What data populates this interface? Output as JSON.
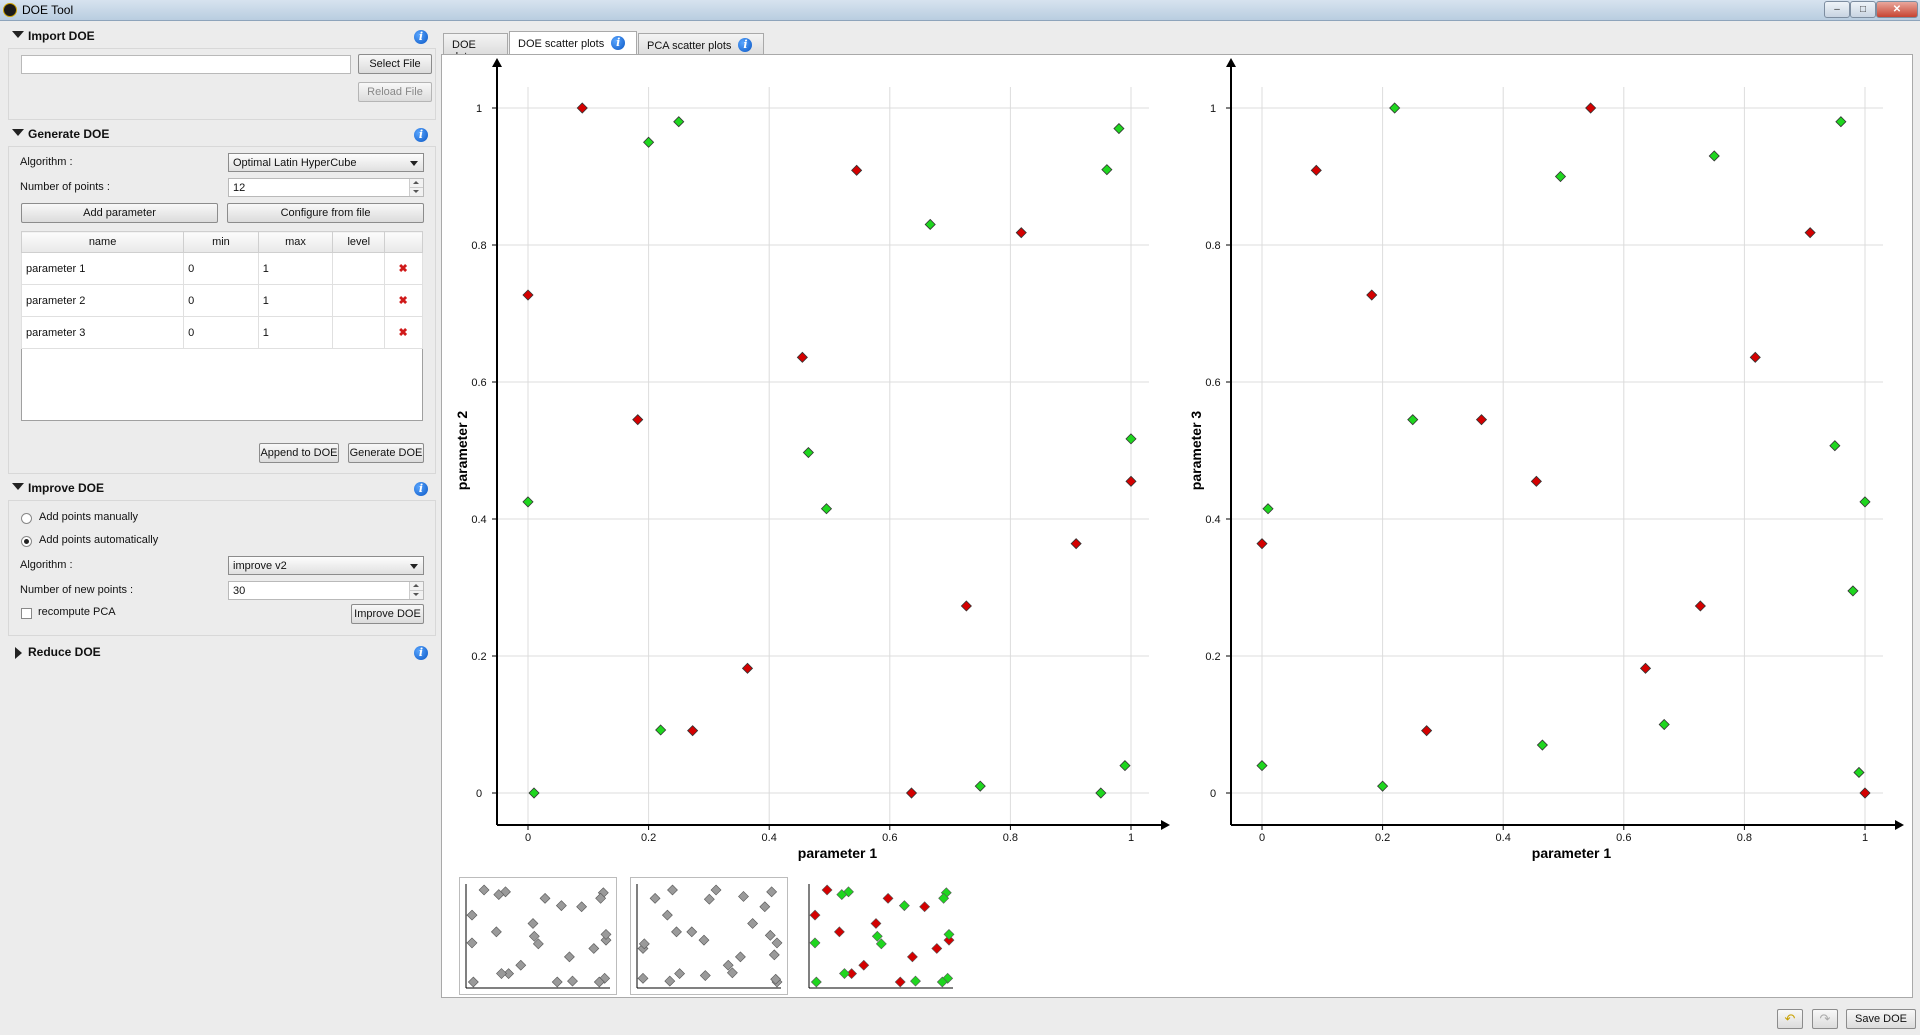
{
  "window": {
    "title": "DOE Tool",
    "buttons": {
      "minimize": "–",
      "maximize": "□",
      "close": "✕"
    }
  },
  "import": {
    "title": "Import DOE",
    "file_value": "",
    "select_label": "Select File",
    "reload_label": "Reload File"
  },
  "generate": {
    "title": "Generate DOE",
    "algorithm_label": "Algorithm :",
    "algorithm_value": "Optimal Latin HyperCube",
    "npoints_label": "Number of points :",
    "npoints_value": "12",
    "add_param_label": "Add parameter",
    "configure_label": "Configure from file",
    "columns": [
      "name",
      "min",
      "max",
      "level"
    ],
    "rows": [
      {
        "name": "parameter 1",
        "min": "0",
        "max": "1",
        "level": ""
      },
      {
        "name": "parameter 2",
        "min": "0",
        "max": "1",
        "level": ""
      },
      {
        "name": "parameter 3",
        "min": "0",
        "max": "1",
        "level": ""
      }
    ],
    "delete_glyph": "✖",
    "append_label": "Append to DOE",
    "generate_label": "Generate DOE"
  },
  "improve": {
    "title": "Improve DOE",
    "manual_label": "Add points manually",
    "auto_label": "Add points automatically",
    "mode_selected": "auto",
    "algorithm_label": "Algorithm :",
    "algorithm_value": "improve v2",
    "newpoints_label": "Number of new points :",
    "newpoints_value": "30",
    "recompute_label": "recompute PCA",
    "recompute_checked": false,
    "improve_label": "Improve DOE"
  },
  "reduce": {
    "title": "Reduce DOE"
  },
  "info_glyph": "i",
  "tabs": [
    {
      "label": "DOE data",
      "active": false,
      "info": false
    },
    {
      "label": "DOE scatter plots",
      "active": true,
      "info": true
    },
    {
      "label": "PCA scatter plots",
      "active": false,
      "info": true
    }
  ],
  "footer": {
    "undo_glyph": "↶",
    "redo_glyph": "↷",
    "save_label": "Save DOE"
  },
  "colors": {
    "red": "#d40000",
    "green": "#1fd61f",
    "grey": "#9a9a9a"
  },
  "chart_data": [
    {
      "type": "scatter",
      "xlabel": "parameter 1",
      "ylabel": "parameter 2",
      "xlim": [
        0,
        1
      ],
      "ylim": [
        0,
        1
      ],
      "xticks": [
        "0",
        "0.2",
        "0.4",
        "0.6",
        "0.8",
        "1"
      ],
      "yticks": [
        "0",
        "0.2",
        "0.4",
        "0.6",
        "0.8",
        "1"
      ],
      "grid": true,
      "series": [
        {
          "color": "#d40000",
          "points": [
            [
              0.09,
              1.0
            ],
            [
              0.0,
              0.727
            ],
            [
              0.545,
              0.909
            ],
            [
              0.818,
              0.818
            ],
            [
              0.455,
              0.636
            ],
            [
              0.182,
              0.545
            ],
            [
              1.0,
              0.455
            ],
            [
              0.909,
              0.364
            ],
            [
              0.727,
              0.273
            ],
            [
              0.364,
              0.182
            ],
            [
              0.273,
              0.091
            ],
            [
              0.636,
              0.0
            ]
          ]
        },
        {
          "color": "#1fd61f",
          "points": [
            [
              0.25,
              0.98
            ],
            [
              0.2,
              0.95
            ],
            [
              0.98,
              0.97
            ],
            [
              0.96,
              0.91
            ],
            [
              0.667,
              0.83
            ],
            [
              1.0,
              0.517
            ],
            [
              0.465,
              0.497
            ],
            [
              0.0,
              0.425
            ],
            [
              0.495,
              0.415
            ],
            [
              0.22,
              0.092
            ],
            [
              0.99,
              0.04
            ],
            [
              0.75,
              0.01
            ],
            [
              0.01,
              0.0
            ],
            [
              0.95,
              0.0
            ]
          ]
        }
      ]
    },
    {
      "type": "scatter",
      "xlabel": "parameter 1",
      "ylabel": "parameter 3",
      "xlim": [
        0,
        1
      ],
      "ylim": [
        0,
        1
      ],
      "xticks": [
        "0",
        "0.2",
        "0.4",
        "0.6",
        "0.8",
        "1"
      ],
      "yticks": [
        "0",
        "0.2",
        "0.4",
        "0.6",
        "0.8",
        "1"
      ],
      "grid": true,
      "series": [
        {
          "color": "#d40000",
          "points": [
            [
              0.545,
              1.0
            ],
            [
              0.09,
              0.909
            ],
            [
              0.909,
              0.818
            ],
            [
              0.182,
              0.727
            ],
            [
              0.818,
              0.636
            ],
            [
              0.364,
              0.545
            ],
            [
              0.455,
              0.455
            ],
            [
              0.0,
              0.364
            ],
            [
              0.727,
              0.273
            ],
            [
              0.636,
              0.182
            ],
            [
              0.273,
              0.091
            ],
            [
              1.0,
              0.0
            ]
          ]
        },
        {
          "color": "#1fd61f",
          "points": [
            [
              0.22,
              1.0
            ],
            [
              0.96,
              0.98
            ],
            [
              0.75,
              0.93
            ],
            [
              0.495,
              0.9
            ],
            [
              0.25,
              0.545
            ],
            [
              0.95,
              0.507
            ],
            [
              1.0,
              0.425
            ],
            [
              0.01,
              0.415
            ],
            [
              0.98,
              0.295
            ],
            [
              0.667,
              0.1
            ],
            [
              0.465,
              0.07
            ],
            [
              0.0,
              0.04
            ],
            [
              0.2,
              0.01
            ],
            [
              0.99,
              0.03
            ]
          ]
        }
      ]
    }
  ]
}
